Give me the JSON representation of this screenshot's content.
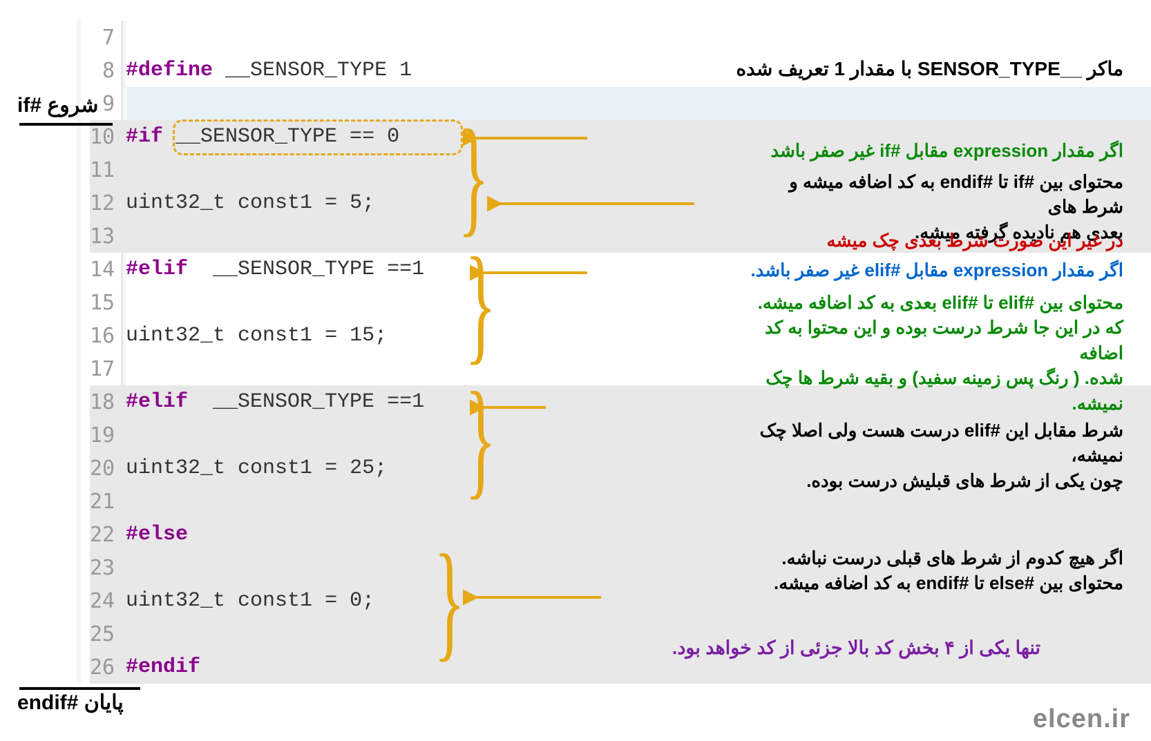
{
  "top_label": {
    "start": "شروع #if",
    "end": "پایان #endif"
  },
  "watermark": "elcen.ir",
  "top_annotation": "ماکر __SENSOR_TYPE با مقدار 1 تعریف شده",
  "lines": {
    "l7": "7",
    "l8": {
      "num": "8",
      "define": "#define",
      "name": " __SENSOR_TYPE ",
      "val": "1"
    },
    "l9": "9",
    "l10": {
      "num": "10",
      "if": "#if",
      "expr": " __SENSOR_TYPE == ",
      "zero": "0"
    },
    "l11": "11",
    "l12": {
      "num": "12",
      "type": "uint32_t ",
      "id": "const1",
      "eq": " = ",
      "val": "5",
      "semi": ";"
    },
    "l13": "13",
    "l14": {
      "num": "14",
      "elif": "#elif",
      "expr": "  __SENSOR_TYPE ==",
      "one": "1"
    },
    "l15": "15",
    "l16": {
      "num": "16",
      "type": "uint32_t ",
      "id": "const1",
      "eq": " = ",
      "val": "15",
      "semi": ";"
    },
    "l17": "17",
    "l18": {
      "num": "18",
      "elif": "#elif",
      "expr": "  __SENSOR_TYPE ==",
      "one": "1"
    },
    "l19": "19",
    "l20": {
      "num": "20",
      "type": "uint32_t ",
      "id": "const1",
      "eq": " = ",
      "val": "25",
      "semi": ";"
    },
    "l21": "21",
    "l22": {
      "num": "22",
      "else": "#else"
    },
    "l23": "23",
    "l24": {
      "num": "24",
      "type": "uint32_t ",
      "id": "const1",
      "eq": " = ",
      "val": "0",
      "semi": ";"
    },
    "l25": "25",
    "l26": {
      "num": "26",
      "endif": "#endif"
    }
  },
  "ann10": {
    "green": "اگر مقدار expression مقابل #if غیر صفر باشد"
  },
  "ann12": {
    "l1": "محتوای بین #if تا #endif به کد اضافه میشه و شرط های",
    "l2": "بعدی هم نادیده گرفته میشه."
  },
  "ann12_red": "در غیر این صورت شرط بعدی چک میشه",
  "ann14": {
    "part1": "اگر مقدار ",
    "part2": "expression",
    "part3": " مقابل ",
    "part4": "#elif",
    "part5": " غیر صفر باشد."
  },
  "ann16": {
    "l1": "محتوای بین #elif تا #elif بعدی به کد اضافه میشه.",
    "l2": "که در این جا شرط درست بوده و این محتوا به کد اضافه",
    "l3": "شده. ( رنگ پس زمینه سفید) و بقیه شرط ها چک نمیشه."
  },
  "ann18": {
    "l1": "شرط مقابل این #elif درست هست ولی اصلا چک نمیشه،",
    "l2": "چون یکی از شرط های قبلیش درست بوده."
  },
  "ann24": {
    "l1": "اگر هیچ کدوم از شرط های قبلی درست نباشه.",
    "l2": "محتوای بین #else تا #endif به کد اضافه میشه."
  },
  "ann_bottom": "تنها یکی از ۴ بخش کد بالا جزئی از کد خواهد بود."
}
